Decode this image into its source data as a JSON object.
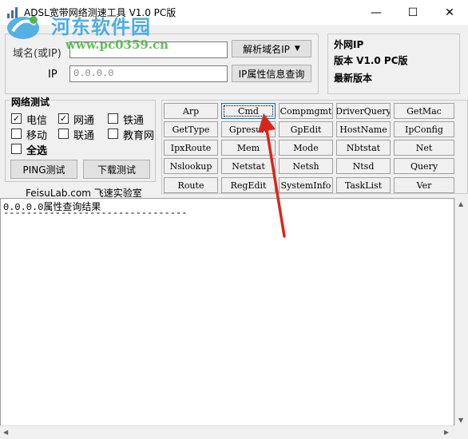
{
  "window": {
    "title": "ADSL宽带网络测速工具 V1.0 PC版",
    "minimize_glyph": "—",
    "maximize_glyph": "☐",
    "close_glyph": "✕"
  },
  "watermark": {
    "text": "河东软件园",
    "url": "www.pc0359.cn"
  },
  "query": {
    "domain_label": "域名(或IP)",
    "domain_value": "",
    "resolve_button": "解析域名IP",
    "resolve_arrow": "▼",
    "ip_label": "IP",
    "ip_value": "0.0.0.0",
    "ip_info_button": "IP属性信息查询"
  },
  "info_panel": {
    "external_ip_label": "外网IP",
    "version_label": "版本 V1.0 PC版",
    "latest_label": "最新版本"
  },
  "network_test": {
    "group_title": "网络测试",
    "options": [
      {
        "label": "电信",
        "checked": true
      },
      {
        "label": "网通",
        "checked": true
      },
      {
        "label": "铁通",
        "checked": false
      },
      {
        "label": "移动",
        "checked": false
      },
      {
        "label": "联通",
        "checked": false
      },
      {
        "label": "教育网",
        "checked": false
      }
    ],
    "select_all": {
      "label": "全选",
      "checked": false
    },
    "ping_button": "PING测试",
    "download_button": "下载测试"
  },
  "lab_label": "FeisuLab.com 飞速实验室",
  "commands": {
    "rows": [
      [
        "Arp",
        "Cmd",
        "Compmgmt",
        "DriverQuery",
        "GetMac"
      ],
      [
        "GetType",
        "Gpresult",
        "GpEdit",
        "HostName",
        "IpConfig"
      ],
      [
        "IpxRoute",
        "Mem",
        "Mode",
        "Nbtstat",
        "Net"
      ],
      [
        "Nslookup",
        "Netstat",
        "Netsh",
        "Ntsd",
        "Query"
      ],
      [
        "Route",
        "RegEdit",
        "SystemInfo",
        "TaskList",
        "Ver"
      ]
    ],
    "focused": "Cmd"
  },
  "output": {
    "line1": "0.0.0.0属性查询结果",
    "line2": "--------------------------------"
  },
  "colors": {
    "client_bg": "#f0f0f0",
    "arrow": "#d9261c",
    "watermark_blue": "#3aa6e2",
    "watermark_green": "#47b33e"
  }
}
